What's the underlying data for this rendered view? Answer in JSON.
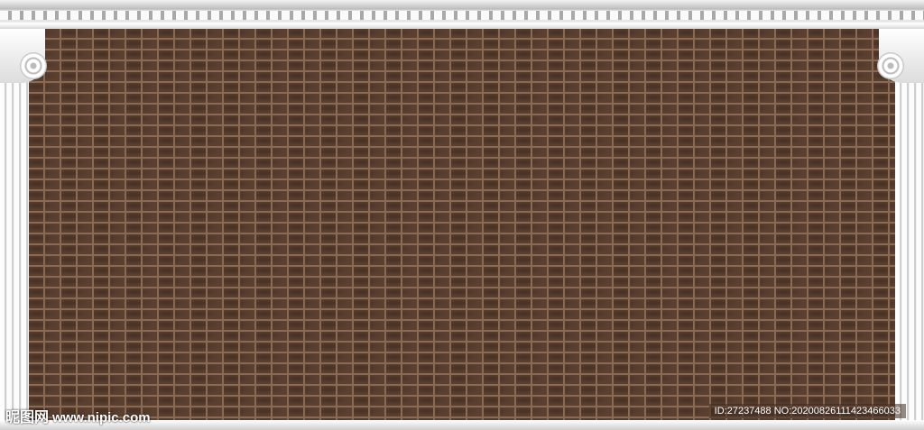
{
  "watermark": {
    "brand": "昵图网",
    "site": "www.nipic.com",
    "id_text": "ID:27237488 NO:20200826111423466033"
  },
  "colors": {
    "brick": "#5b4031",
    "mortar": "#8a6a52",
    "column": "#f0f0f0"
  }
}
